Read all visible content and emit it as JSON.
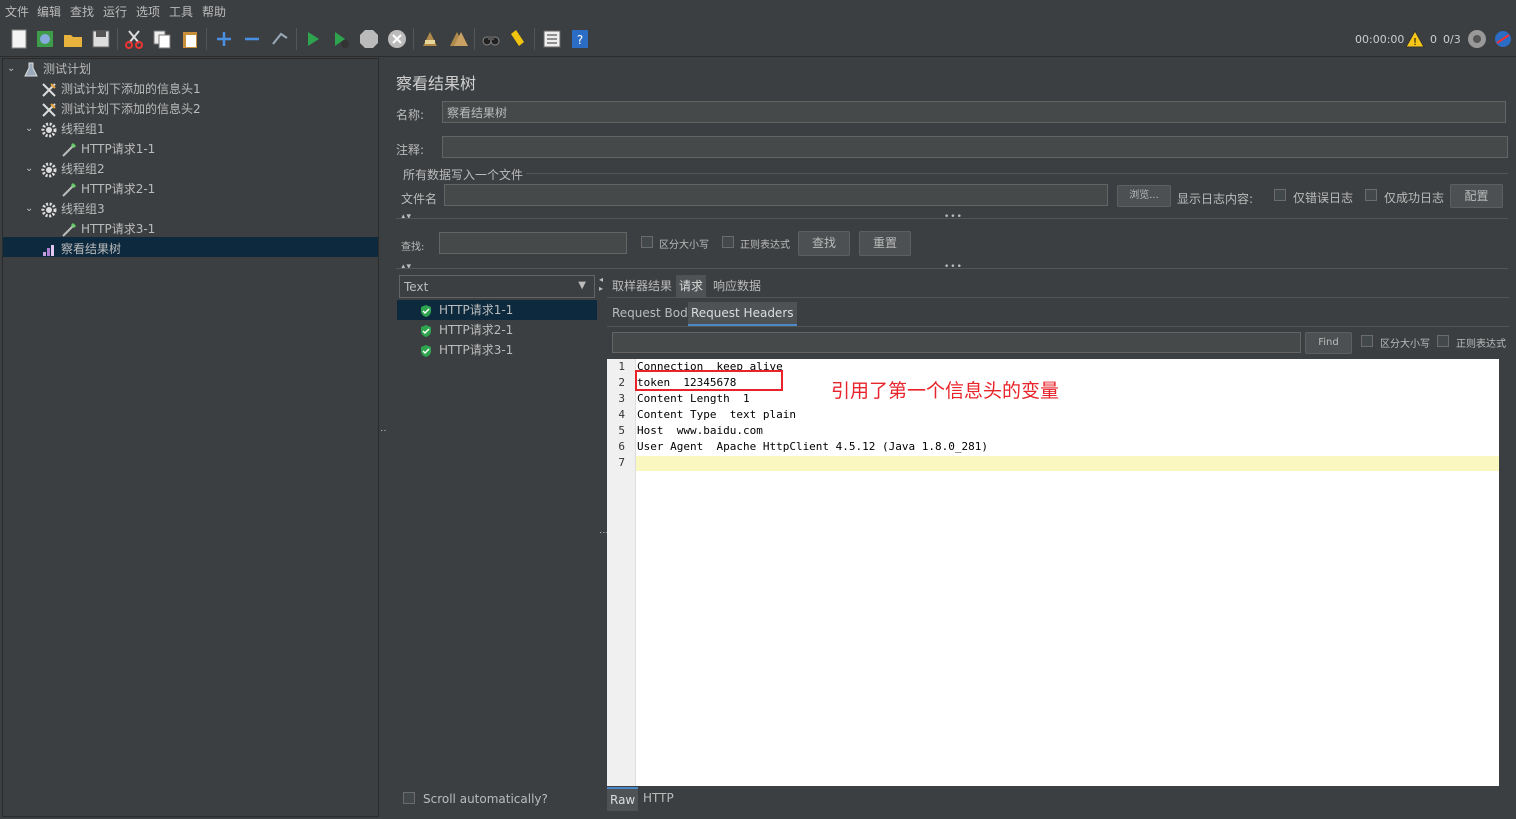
{
  "menu": [
    "文件",
    "编辑",
    "查找",
    "运行",
    "选项",
    "工具",
    "帮助"
  ],
  "status": {
    "timer": "00:00:00",
    "warnings": "0",
    "threads": "0/3"
  },
  "tree": {
    "nodes": [
      {
        "label": "测试计划",
        "icon": "flask-icon"
      },
      {
        "label": "测试计划下添加的信息头1",
        "icon": "wrench-icon"
      },
      {
        "label": "测试计划下添加的信息头2",
        "icon": "wrench-icon"
      },
      {
        "label": "线程组1",
        "icon": "gear-icon"
      },
      {
        "label": "HTTP请求1-1",
        "icon": "pipette-icon"
      },
      {
        "label": "线程组2",
        "icon": "gear-icon"
      },
      {
        "label": "HTTP请求2-1",
        "icon": "pipette-icon"
      },
      {
        "label": "线程组3",
        "icon": "gear-icon"
      },
      {
        "label": "HTTP请求3-1",
        "icon": "pipette-icon"
      },
      {
        "label": "察看结果树",
        "icon": "chart-icon"
      }
    ]
  },
  "panel": {
    "title": "察看结果树",
    "name_label": "名称:",
    "name_value": "察看结果树",
    "comment_label": "注释:",
    "comment_value": "",
    "file_section": "所有数据写入一个文件",
    "filename_label": "文件名",
    "filename_value": "",
    "browse_btn": "浏览...",
    "log_label": "显示日志内容:",
    "errors_only": "仅错误日志",
    "success_only": "仅成功日志",
    "config_btn": "配置",
    "search_label": "查找:",
    "search_value": "",
    "case_sensitive": "区分大小写",
    "regex": "正则表达式",
    "find_btn": "查找",
    "reset_btn": "重置"
  },
  "results": {
    "renderer": "Text",
    "items": [
      "HTTP请求1-1",
      "HTTP请求2-1",
      "HTTP请求3-1"
    ],
    "scroll_auto": "Scroll automatically?"
  },
  "detail": {
    "tabs": [
      "取样器结果",
      "请求",
      "响应数据"
    ],
    "subtabs": [
      "Request Body",
      "Request Headers"
    ],
    "find_btn": "Find",
    "case_sensitive": "区分大小写",
    "regex": "正则表达式",
    "bottom_tabs": [
      "Raw",
      "HTTP"
    ]
  },
  "code_lines": [
    "Connection  keep alive",
    "token  12345678",
    "Content Length  1",
    "Content Type  text plain",
    "Host  www.baidu.com",
    "User Agent  Apache HttpClient 4.5.12 (Java 1.8.0_281)",
    ""
  ],
  "annotation": "引用了第一个信息头的变量",
  "colors": {
    "annotation": "#e8232a",
    "selection": "#0d293e",
    "editor_bg": "#ffffff",
    "current_line": "#fbf7c0"
  }
}
